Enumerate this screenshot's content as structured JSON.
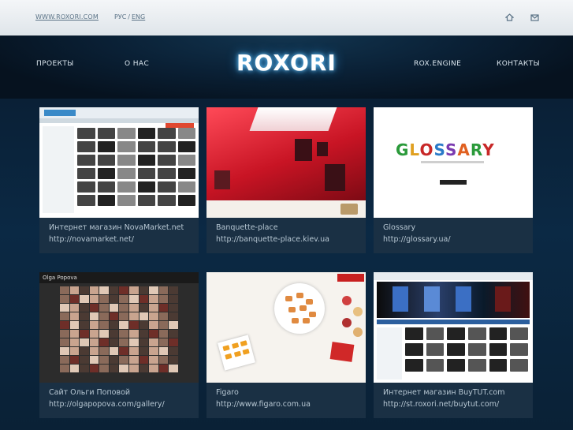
{
  "header": {
    "site_link": "WWW.ROXORI.COM",
    "lang_ru": "РУС",
    "lang_sep": "/",
    "lang_en": "ENG",
    "icons": [
      "home-icon",
      "mail-icon"
    ]
  },
  "nav": {
    "items": [
      "ПРОЕКТЫ",
      "О НАС",
      "ROX.ENGINE",
      "КОНТАКТЫ"
    ],
    "logo": "ROXORI"
  },
  "projects": [
    {
      "title": "Интернет магазин NovaMarket.net",
      "url": "http://novamarket.net/"
    },
    {
      "title": "Banquette-place",
      "url": "http://banquette-place.kiev.ua"
    },
    {
      "title": "Glossary",
      "url": "http://glossary.ua/"
    },
    {
      "title": "Сайт Ольги Поповой",
      "url": "http://olgapopova.com/gallery/"
    },
    {
      "title": "Figaro",
      "url": "http://www.figaro.com.ua"
    },
    {
      "title": "Интернет магазин BuyTUT.com",
      "url": "http://st.roxori.net/buytut.com/"
    }
  ],
  "thumbnails": {
    "glossary_word": "GLOSSARY",
    "olga_name": "Olga Popova"
  },
  "colors": {
    "background": "#06121f",
    "card": "#1a3044",
    "text": "#b7c7d3",
    "logo_glow": "#6cc9ff"
  }
}
